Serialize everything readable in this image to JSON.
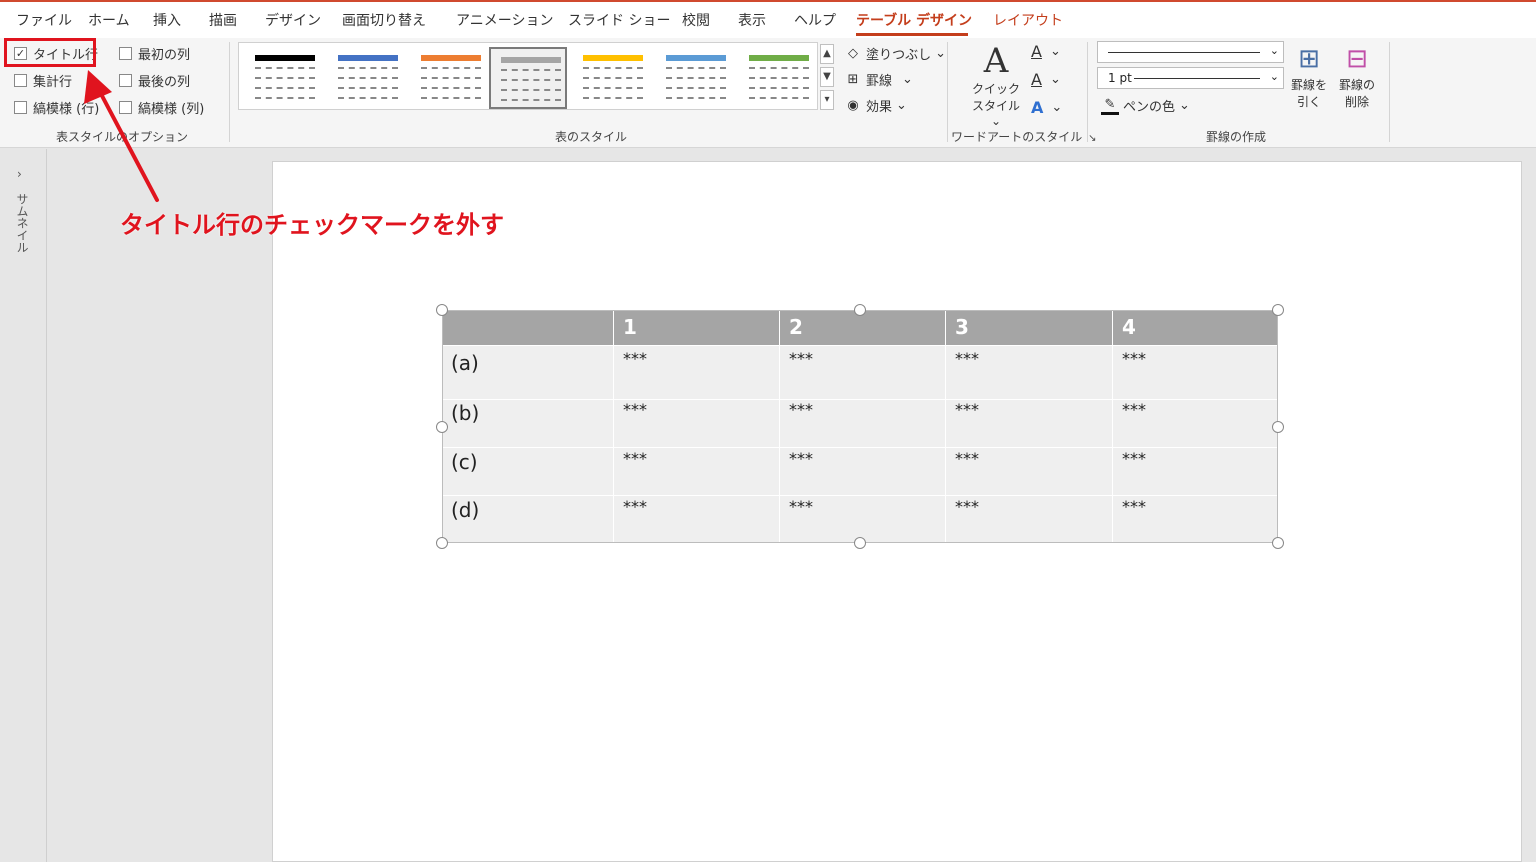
{
  "tabs": [
    {
      "label": "ファイル"
    },
    {
      "label": "ホーム"
    },
    {
      "label": "挿入"
    },
    {
      "label": "描画"
    },
    {
      "label": "デザイン"
    },
    {
      "label": "画面切り替え"
    },
    {
      "label": "アニメーション"
    },
    {
      "label": "スライド ショー"
    },
    {
      "label": "校閲"
    },
    {
      "label": "表示"
    },
    {
      "label": "ヘルプ"
    },
    {
      "label": "テーブル デザイン"
    },
    {
      "label": "レイアウト"
    }
  ],
  "style_options": {
    "title_row": "タイトル行",
    "total_row": "集計行",
    "banded_rows": "縞模様 (行)",
    "first_column": "最初の列",
    "last_column": "最後の列",
    "banded_columns": "縞模様 (列)",
    "group_label": "表スタイルのオプション",
    "title_row_checked": true
  },
  "table_styles": {
    "group_label": "表のスタイル",
    "fill": "塗りつぶし",
    "border": "罫線",
    "effect": "効果",
    "colors": [
      "#000000",
      "#4472c4",
      "#ed7d31",
      "#a5a5a5",
      "#ffc000",
      "#5b9bd5",
      "#70ad47"
    ]
  },
  "wordart": {
    "quick_style_1": "クイック",
    "quick_style_2": "スタイル",
    "group_label": "ワードアートのスタイル"
  },
  "borders": {
    "weight": "1 pt",
    "pen_color": "ペンの色",
    "draw_1": "罫線を",
    "draw_2": "引く",
    "erase_1": "罫線の",
    "erase_2": "削除",
    "group_label": "罫線の作成"
  },
  "thumbnail_pane": {
    "label": "サムネイル"
  },
  "annotation": "タイトル行のチェックマークを外す",
  "table": {
    "header": [
      "",
      "1",
      "2",
      "3",
      "4"
    ],
    "rows": [
      [
        "(a)",
        "***",
        "***",
        "***",
        "***"
      ],
      [
        "(b)",
        "***",
        "***",
        "***",
        "***"
      ],
      [
        "(c)",
        "***",
        "***",
        "***",
        "***"
      ],
      [
        "(d)",
        "***",
        "***",
        "***",
        "***"
      ]
    ]
  }
}
